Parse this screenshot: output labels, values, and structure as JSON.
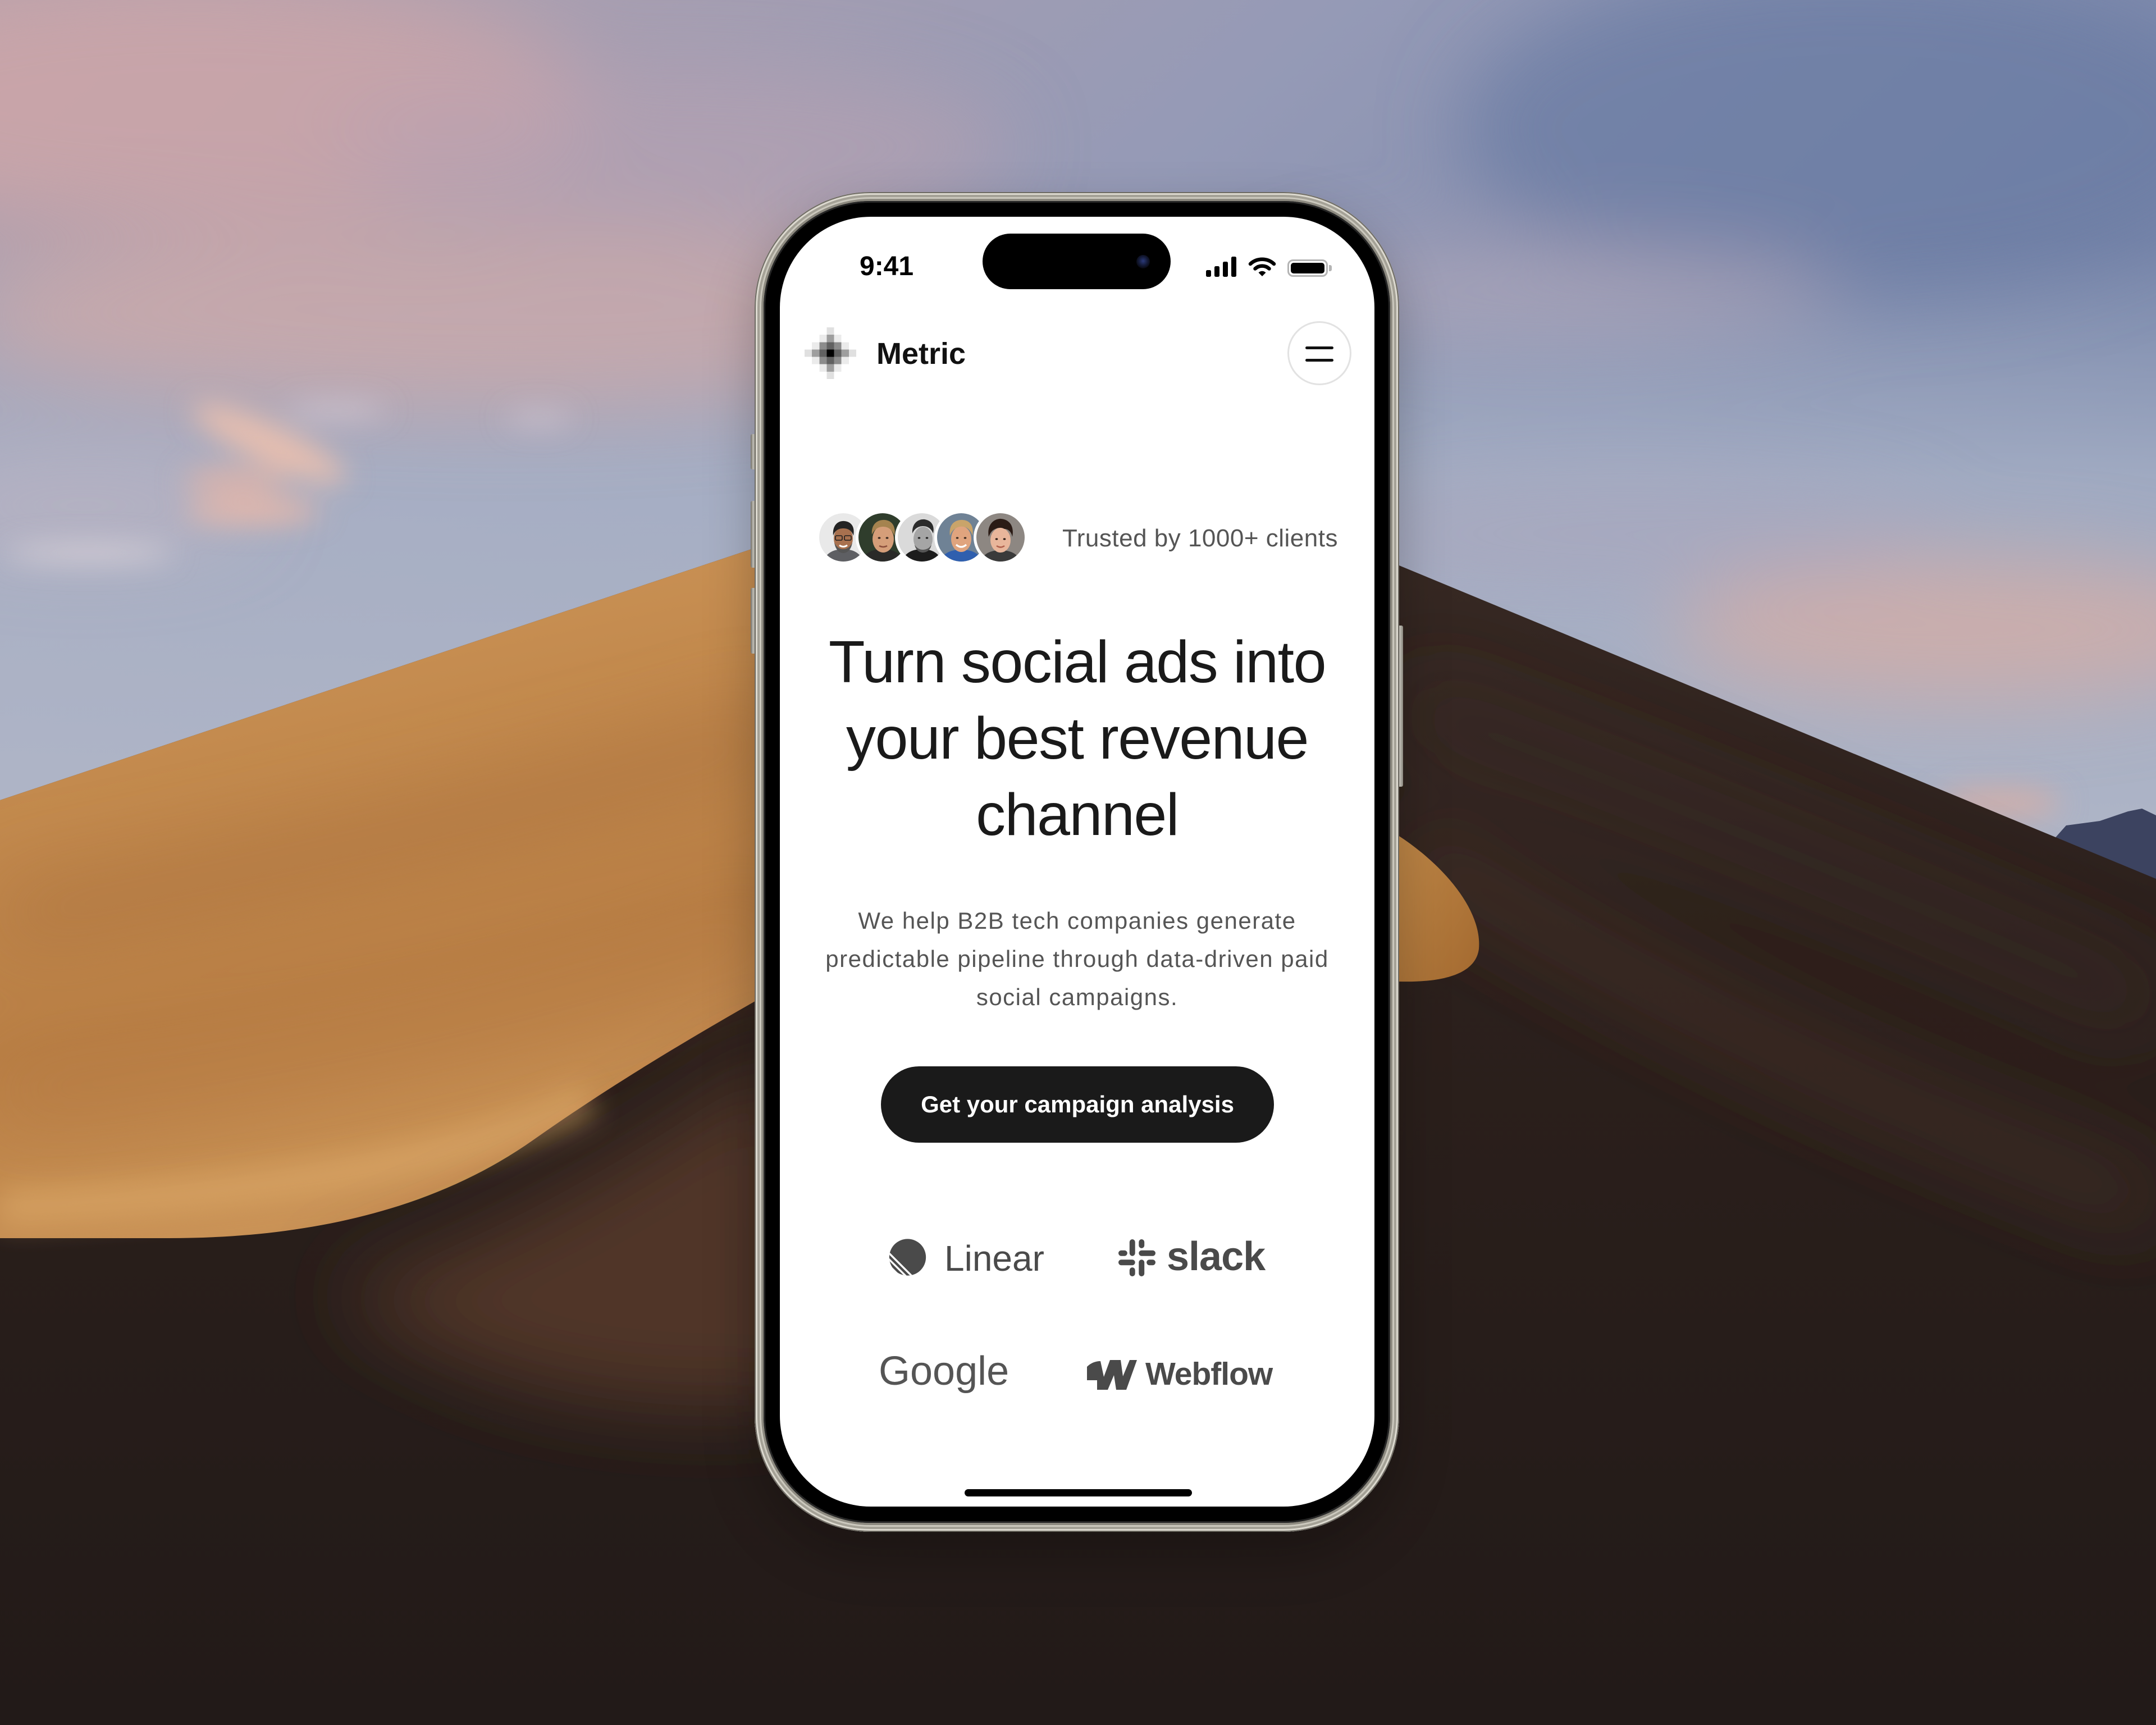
{
  "status_bar": {
    "time": "9:41",
    "icons": [
      "signal-icon",
      "wifi-icon",
      "battery-icon"
    ]
  },
  "nav": {
    "brand_name": "Metric",
    "logo_icon": "pixel-star-logo-icon",
    "menu_icon": "menu-icon"
  },
  "hero": {
    "social_proof_text": "Trusted by 1000+ clients",
    "headline_lines": [
      "Turn social ads into",
      "your best revenue",
      "channel"
    ],
    "subtitle_lines": [
      "We help B2B tech companies generate",
      "predictable pipeline through data-driven paid",
      "social campaigns."
    ],
    "cta_label": "Get your campaign analysis"
  },
  "client_logos": [
    {
      "name": "Linear",
      "icon": "linear-icon"
    },
    {
      "name": "slack",
      "icon": "slack-icon"
    },
    {
      "name": "Google"
    },
    {
      "name": "Webflow",
      "icon": "webflow-icon"
    }
  ],
  "theme": {
    "text_primary": "#1a1a1a",
    "text_secondary": "#555555",
    "cta_bg": "#1a1a1a",
    "cta_text": "#ffffff",
    "logo_gray": "#4a4a4a",
    "screen_bg": "#ffffff"
  }
}
